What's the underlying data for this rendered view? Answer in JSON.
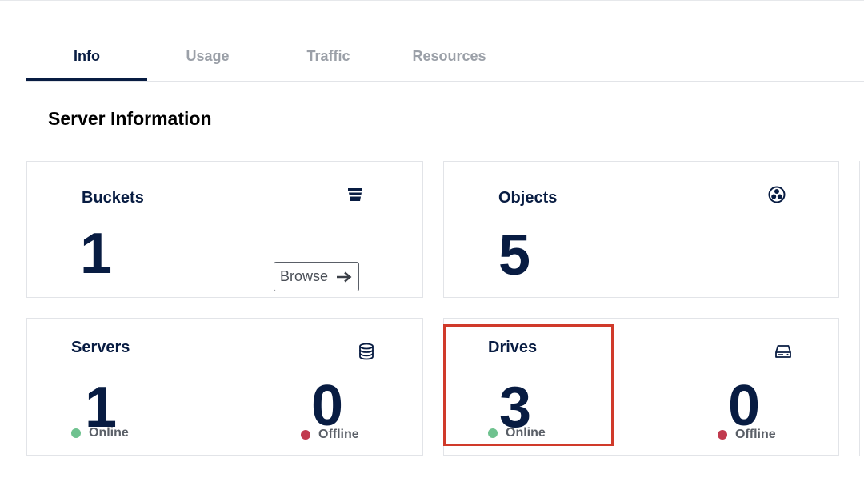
{
  "tabs": [
    {
      "label": "Info",
      "active": true
    },
    {
      "label": "Usage",
      "active": false
    },
    {
      "label": "Traffic",
      "active": false
    },
    {
      "label": "Resources",
      "active": false
    }
  ],
  "section": {
    "title": "Server Information"
  },
  "cards": {
    "buckets": {
      "title": "Buckets",
      "value": "1",
      "icon": "bucket-icon",
      "browse_label": "Browse"
    },
    "objects": {
      "title": "Objects",
      "value": "5",
      "icon": "objects-icon"
    },
    "servers": {
      "title": "Servers",
      "online_value": "1",
      "online_label": "Online",
      "offline_value": "0",
      "offline_label": "Offline",
      "icon": "database-icon"
    },
    "drives": {
      "title": "Drives",
      "online_value": "3",
      "online_label": "Online",
      "offline_value": "0",
      "offline_label": "Offline",
      "icon": "hard-drive-icon"
    }
  },
  "colors": {
    "primary": "#081c42",
    "online": "#6fc28f",
    "offline": "#c13a4e",
    "highlight": "#d03a2a",
    "tab_inactive": "#9ba0a8"
  }
}
